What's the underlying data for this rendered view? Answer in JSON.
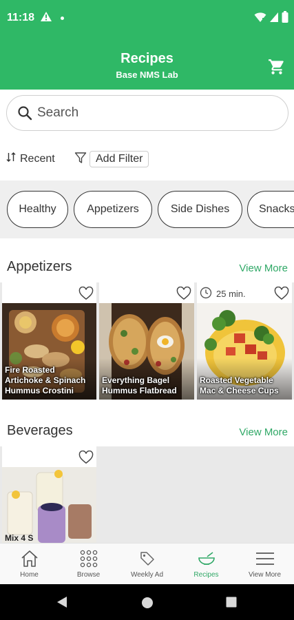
{
  "status_bar": {
    "time": "11:18"
  },
  "header": {
    "title": "Recipes",
    "subtitle": "Base NMS Lab"
  },
  "search": {
    "placeholder": "Search"
  },
  "toolbar": {
    "sort_label": "Recent",
    "filter_label": "Add Filter"
  },
  "chips": [
    "Healthy",
    "Appetizers",
    "Side Dishes",
    "Snacks"
  ],
  "sections": [
    {
      "title": "Appetizers",
      "view_more": "View More",
      "cards": [
        {
          "name": "Fire Roasted Artichoke & Spinach Hummus Crostini"
        },
        {
          "name": "Everything Bagel Hummus Flatbread"
        },
        {
          "name": "Roasted Vegetable Mac & Cheese Cups",
          "time": "25 min."
        }
      ]
    },
    {
      "title": "Beverages",
      "view_more": "View More",
      "cards": [
        {
          "name": "Mix 4 S"
        }
      ]
    }
  ],
  "bottom_nav": [
    {
      "label": "Home",
      "icon": "home-icon"
    },
    {
      "label": "Browse",
      "icon": "grid-icon"
    },
    {
      "label": "Weekly Ad",
      "icon": "tag-icon"
    },
    {
      "label": "Recipes",
      "icon": "bowl-icon",
      "active": true
    },
    {
      "label": "View More",
      "icon": "hamburger-icon"
    }
  ],
  "colors": {
    "primary": "#2fb866",
    "accent_text": "#2fa866"
  }
}
